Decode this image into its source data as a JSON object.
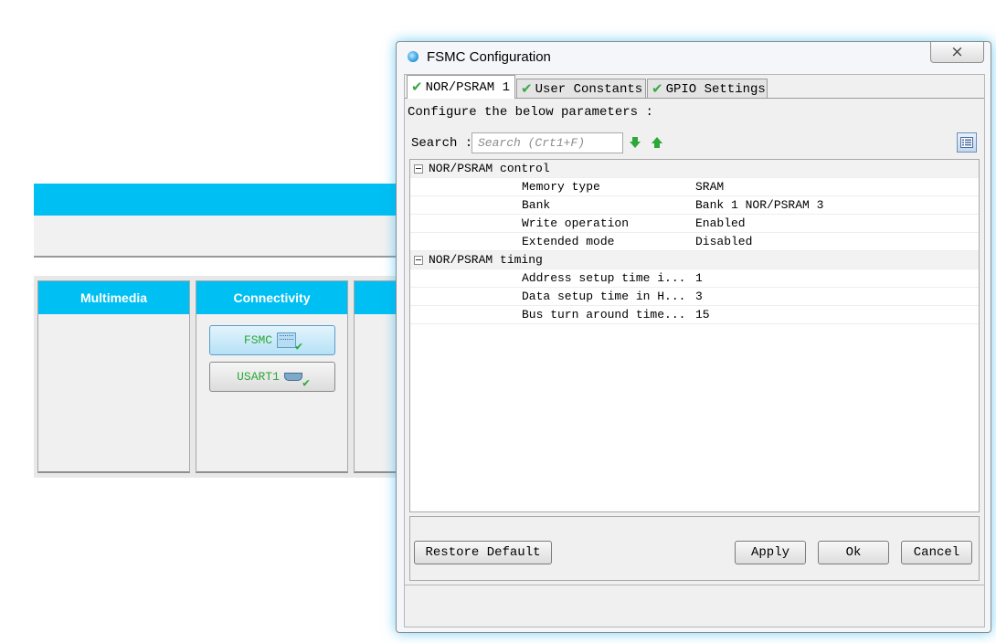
{
  "background": {
    "categories": [
      {
        "label": "Multimedia",
        "peripherals": []
      },
      {
        "label": "Connectivity",
        "peripherals": [
          {
            "label": "FSMC",
            "icon": "chip-icon"
          },
          {
            "label": "USART1",
            "icon": "serial-port-icon"
          }
        ]
      },
      {
        "label": ""
      }
    ]
  },
  "dialog": {
    "title": "FSMC Configuration",
    "close_symbol": "⨯",
    "tabs": [
      {
        "label": "NOR/PSRAM 1",
        "active": true
      },
      {
        "label": "User Constants",
        "active": false
      },
      {
        "label": "GPIO Settings",
        "active": false
      }
    ],
    "intro": "Configure the below parameters :",
    "search": {
      "label": "Search :",
      "placeholder": "Search (Crt1+F)"
    },
    "groups": [
      {
        "label": "NOR/PSRAM control",
        "params": [
          {
            "name": "Memory type",
            "value": "SRAM"
          },
          {
            "name": "Bank",
            "value": "Bank 1 NOR/PSRAM 3"
          },
          {
            "name": "Write operation",
            "value": "Enabled"
          },
          {
            "name": "Extended mode",
            "value": "Disabled"
          }
        ]
      },
      {
        "label": "NOR/PSRAM timing",
        "params": [
          {
            "name": "Address setup time i...",
            "value": "1"
          },
          {
            "name": "Data setup time in H...",
            "value": "3"
          },
          {
            "name": "Bus turn around time...",
            "value": "15"
          }
        ]
      }
    ],
    "buttons": {
      "restore": "Restore Default",
      "apply": "Apply",
      "ok": "Ok",
      "cancel": "Cancel"
    }
  },
  "colors": {
    "accent": "#00bff3",
    "check_green": "#3aa847",
    "arrow_green": "#2ca838"
  }
}
